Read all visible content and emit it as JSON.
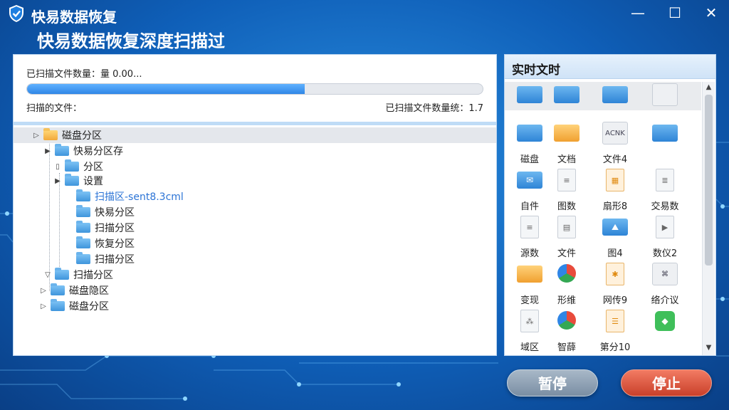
{
  "app": {
    "title": "快易数据恢复",
    "subtitle": "快易数据恢复深度扫描过"
  },
  "window_controls": {
    "minimize": "—",
    "maximize": "☐",
    "close": "✕"
  },
  "scan": {
    "status_text": "已扫描文件数量：量 0.00...",
    "progress_percent": 61,
    "scanning_label": "扫描的文件：",
    "scanned_count_text": "已扫描文件数量统：1.7"
  },
  "tree": [
    {
      "label": "磁盘分区",
      "toggle": "▷",
      "folder": "yellow"
    },
    {
      "label": "快易分区存",
      "toggle": "▶",
      "folder": "blue"
    },
    {
      "label": "分区",
      "toggle": "▯",
      "folder": "blue"
    },
    {
      "label": "设置",
      "toggle": "▶",
      "folder": "blue"
    },
    {
      "label": "扫描区-sent8.3cml",
      "toggle": "",
      "folder": "blue",
      "highlight": true
    },
    {
      "label": "快易分区",
      "toggle": "",
      "folder": "blue"
    },
    {
      "label": "扫描分区",
      "toggle": "",
      "folder": "blue"
    },
    {
      "label": "恢复分区",
      "toggle": "",
      "folder": "blue"
    },
    {
      "label": "扫描分区",
      "toggle": "",
      "folder": "blue"
    },
    {
      "label": "扫描分区",
      "toggle": "▽",
      "folder": "blue"
    },
    {
      "label": "磁盘隐区",
      "toggle": "▷",
      "folder": "blue"
    },
    {
      "label": "磁盘分区",
      "toggle": "▷",
      "folder": "blue"
    }
  ],
  "right_panel": {
    "header": "实时文时",
    "top_row_icons": [
      "folder-blue-icon",
      "folder-blue-icon",
      "folder-blue-icon",
      "placeholder-icon"
    ],
    "files": [
      {
        "label": "磁盘",
        "icon": "folder-blue-icon",
        "glyph": ""
      },
      {
        "label": "文档",
        "icon": "folder-yellow-icon",
        "glyph": ""
      },
      {
        "label": "文件4",
        "icon": "acnk-file-icon",
        "glyph": "ACNK"
      },
      {
        "label": "",
        "icon": "folder-open-icon",
        "glyph": ""
      },
      {
        "label": "自件",
        "icon": "mail-folder-icon",
        "glyph": "✉"
      },
      {
        "label": "图数",
        "icon": "document-icon",
        "glyph": "≡"
      },
      {
        "label": "扇形8",
        "icon": "image-file-icon",
        "glyph": "▦"
      },
      {
        "label": "交易数",
        "icon": "text-file-icon",
        "glyph": "≣"
      },
      {
        "label": "源数",
        "icon": "document-icon",
        "glyph": "≡"
      },
      {
        "label": "文件",
        "icon": "spreadsheet-icon",
        "glyph": "▤"
      },
      {
        "label": "图4",
        "icon": "picture-file-icon",
        "glyph": "⛰"
      },
      {
        "label": "数仪2",
        "icon": "video-file-icon",
        "glyph": "▶"
      },
      {
        "label": "变现",
        "icon": "folder-yellow-icon",
        "glyph": ""
      },
      {
        "label": "形维",
        "icon": "chrome-icon",
        "glyph": ""
      },
      {
        "label": "网传9",
        "icon": "archive-file-icon",
        "glyph": "✱"
      },
      {
        "label": "络介议",
        "icon": "key-file-icon",
        "glyph": "⌘"
      },
      {
        "label": "域区",
        "icon": "network-file-icon",
        "glyph": "⁂"
      },
      {
        "label": "智薛",
        "icon": "circle-app-icon",
        "glyph": ""
      },
      {
        "label": "第分10",
        "icon": "orange-doc-icon",
        "glyph": "☰"
      },
      {
        "label": "",
        "icon": "green-app-icon",
        "glyph": "◆"
      }
    ]
  },
  "buttons": {
    "pause": "暂停",
    "stop": "停止"
  }
}
